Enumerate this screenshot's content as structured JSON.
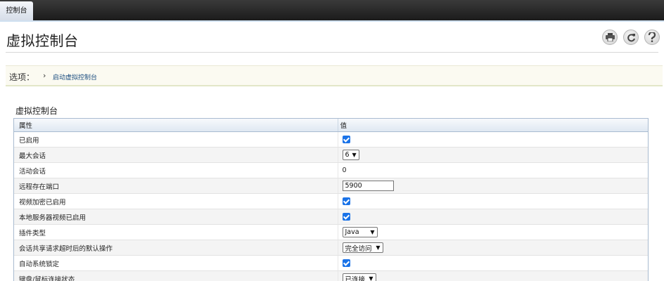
{
  "topbar": {
    "tab_label": "控制台"
  },
  "page": {
    "title": "虚拟控制台"
  },
  "toolbar": {
    "print_icon": "print-icon",
    "refresh_icon": "refresh-icon",
    "help_icon": "help-icon"
  },
  "options": {
    "label": "选项：",
    "chevron": "›",
    "link_label": "启动虚拟控制台"
  },
  "section": {
    "title": "虚拟控制台"
  },
  "table": {
    "headers": {
      "property": "属性",
      "value": "值"
    },
    "rows": [
      {
        "property": "已启用",
        "value_type": "checkbox",
        "checked": true
      },
      {
        "property": "最大会话",
        "value_type": "select",
        "value": "6"
      },
      {
        "property": "活动会话",
        "value_type": "text",
        "value": "0"
      },
      {
        "property": "远程存在端口",
        "value_type": "input",
        "value": "5900"
      },
      {
        "property": "视频加密已启用",
        "value_type": "checkbox",
        "checked": true
      },
      {
        "property": "本地服务器视频已启用",
        "value_type": "checkbox",
        "checked": true
      },
      {
        "property": "插件类型",
        "value_type": "select",
        "value": "Java"
      },
      {
        "property": "会话共享请求超时后的默认操作",
        "value_type": "select",
        "value": "完全访问"
      },
      {
        "property": "自动系统锁定",
        "value_type": "checkbox",
        "checked": true
      },
      {
        "property": "键盘/鼠标连接状态",
        "value_type": "select",
        "value": "已连接"
      }
    ]
  }
}
